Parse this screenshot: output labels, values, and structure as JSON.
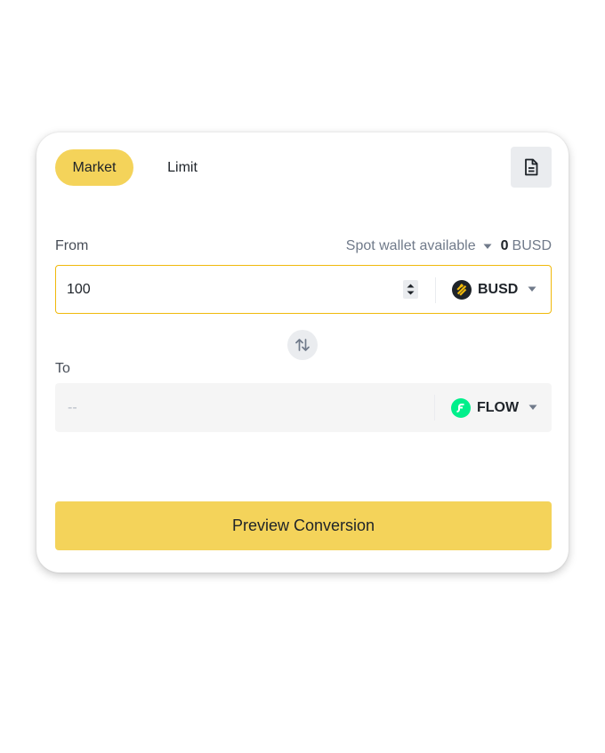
{
  "tabs": [
    {
      "label": "Market",
      "active": true
    },
    {
      "label": "Limit",
      "active": false
    }
  ],
  "history_icon": "document-icon",
  "from": {
    "label": "From",
    "wallet_label": "Spot wallet available",
    "wallet_amount": "0",
    "wallet_unit": "BUSD",
    "value": "100",
    "coin": "BUSD",
    "coin_icon": "busd-coin-icon",
    "coin_color": "#1e2329"
  },
  "swap_icon": "swap-arrows-icon",
  "to": {
    "label": "To",
    "value": "--",
    "coin": "FLOW",
    "coin_icon": "flow-coin-icon",
    "coin_color": "#00ef8b"
  },
  "preview_button": "Preview Conversion",
  "colors": {
    "accent": "#f4d35a",
    "focus_border": "#f0b90b",
    "text_primary": "#1e2329",
    "text_secondary": "#707a8a"
  }
}
